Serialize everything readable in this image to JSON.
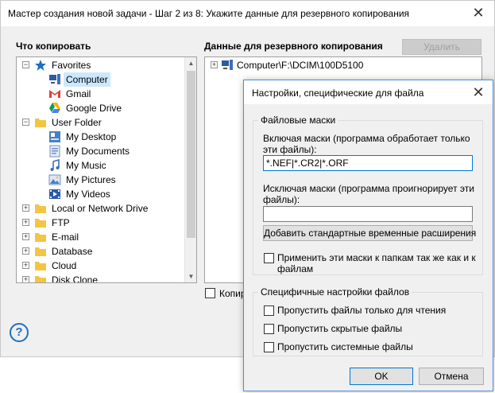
{
  "window": {
    "title": "Мастер создания новой задачи - Шаг 2 из 8: Укажите данные для резервного копирования",
    "close": "✕"
  },
  "left": {
    "heading": "Что копировать",
    "tree": [
      {
        "label": "Favorites",
        "icon": "star-icon",
        "expander": "−"
      },
      {
        "label": "Computer",
        "icon": "computer-icon"
      },
      {
        "label": "Gmail",
        "icon": "gmail-icon"
      },
      {
        "label": "Google Drive",
        "icon": "google-drive-icon"
      },
      {
        "label": "User Folder",
        "icon": "folder-icon",
        "expander": "−"
      },
      {
        "label": "My Desktop",
        "icon": "desktop-icon"
      },
      {
        "label": "My Documents",
        "icon": "documents-icon"
      },
      {
        "label": "My Music",
        "icon": "music-icon"
      },
      {
        "label": "My Pictures",
        "icon": "pictures-icon"
      },
      {
        "label": "My Videos",
        "icon": "videos-icon"
      },
      {
        "label": "Local or Network Drive",
        "icon": "folder-icon",
        "expander": "+"
      },
      {
        "label": "FTP",
        "icon": "folder-icon",
        "expander": "+"
      },
      {
        "label": "E-mail",
        "icon": "folder-icon",
        "expander": "+"
      },
      {
        "label": "Database",
        "icon": "folder-icon",
        "expander": "+"
      },
      {
        "label": "Cloud",
        "icon": "folder-icon",
        "expander": "+"
      },
      {
        "label": "Disk Clone",
        "icon": "folder-icon",
        "expander": "+"
      }
    ]
  },
  "right": {
    "heading": "Данные для резервного копирования",
    "delete_button": "Удалить",
    "tree_item": "Computer\\F:\\DCIM\\100D5100",
    "copy_checkbox_label": "Копир"
  },
  "help": "?",
  "dialog": {
    "title": "Настройки, специфические для файла",
    "close": "✕",
    "masks_group": "Файловые маски",
    "include_label": "Включая маски (программа обработает только эти файлы):",
    "include_value": "*.NEF|*.CR2|*.ORF",
    "exclude_label": "Исключая маски (программа проигнорирует эти файлы):",
    "exclude_value": "",
    "add_temp_button": "Добавить стандартные временные расширения",
    "apply_folders_label": "Применить эти маски к папкам так же как и к файлам",
    "specific_group": "Специфичные настройки файлов",
    "skip_readonly": "Пропустить файлы только для чтения",
    "skip_hidden": "Пропустить скрытые файлы",
    "skip_system": "Пропустить системные файлы",
    "ok": "OK",
    "cancel": "Отмена"
  },
  "colors": {
    "accent": "#0078d7",
    "selection": "#cce8ff",
    "folder": "#f4c542",
    "star": "#1e6fc0"
  }
}
